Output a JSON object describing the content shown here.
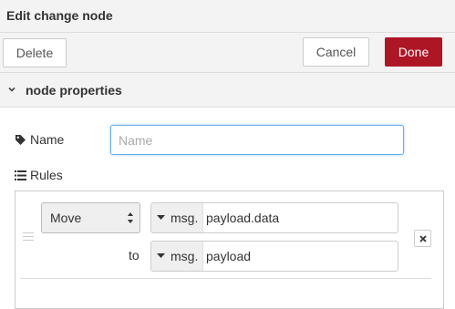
{
  "window": {
    "title": "Edit change node"
  },
  "toolbar": {
    "delete_label": "Delete",
    "cancel_label": "Cancel",
    "done_label": "Done"
  },
  "section": {
    "label": "node properties",
    "icon": "chevron-down-icon"
  },
  "name_field": {
    "label": "Name",
    "placeholder": "Name",
    "value": "",
    "icon": "tag-icon"
  },
  "rules": {
    "label": "Rules",
    "icon": "list-icon",
    "items": [
      {
        "action": "Move",
        "source": {
          "type_prefix": "msg.",
          "value": "payload.data"
        },
        "to_label": "to",
        "target": {
          "type_prefix": "msg.",
          "value": "payload"
        }
      }
    ]
  },
  "colors": {
    "accent": "#ad1625",
    "focus": "#66afe9",
    "header_bg": "#f3f3f3"
  }
}
